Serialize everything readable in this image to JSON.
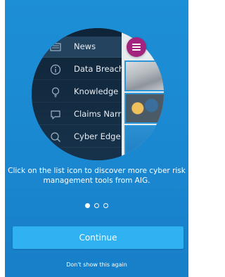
{
  "menu": {
    "items": [
      {
        "label": "News",
        "icon": "news-icon",
        "active": true
      },
      {
        "label": "Data Breach",
        "icon": "info-icon",
        "active": false
      },
      {
        "label": "Knowledge",
        "icon": "lightbulb-icon",
        "active": false
      },
      {
        "label": "Claims Narr",
        "icon": "chat-icon",
        "active": false
      },
      {
        "label": "Cyber Edge",
        "icon": "search-icon",
        "active": false
      }
    ]
  },
  "instruction": "Click on the list icon to discover more cyber risk management tools from AIG.",
  "pager": {
    "pages": 3,
    "active": 0
  },
  "continue_label": "Continue",
  "dont_show_label": "Don't show this again",
  "colors": {
    "background": "#1a88d1",
    "button": "#2fb1f2",
    "hamburger": "#a3247f",
    "menu_panel": "#132b3e"
  }
}
